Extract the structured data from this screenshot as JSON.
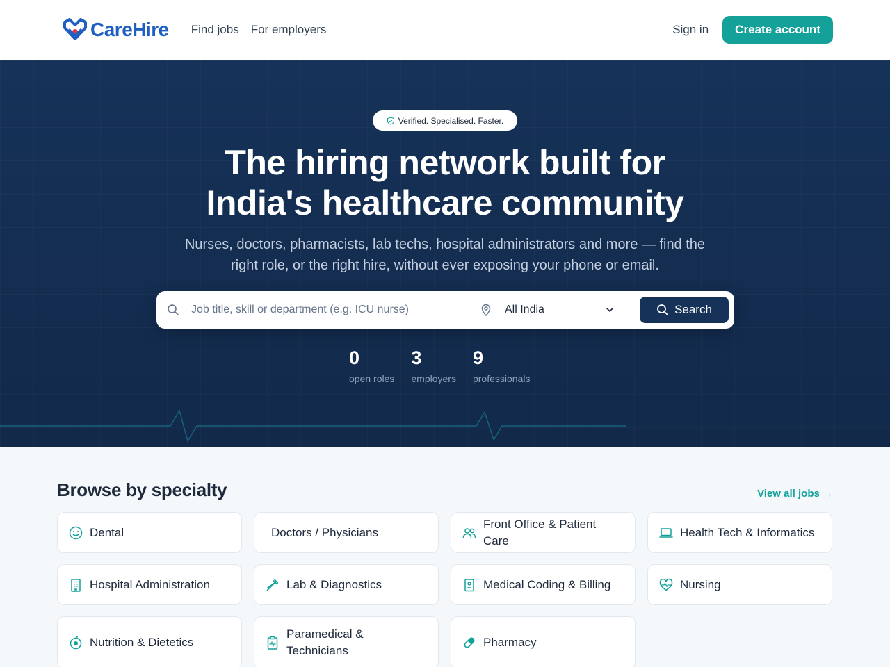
{
  "brand": {
    "name": "CareHire",
    "accent": "#14a19a",
    "navy": "#163258",
    "logo_blue": "#1f5fc2"
  },
  "header": {
    "nav": [
      "Find jobs",
      "For employers"
    ],
    "sign_in": "Sign in",
    "create_account": "Create account"
  },
  "hero": {
    "badge": "Verified. Specialised. Faster.",
    "title_line1": "The hiring network built for",
    "title_line2": "India's healthcare community",
    "subtitle_line1": "Nurses, doctors, pharmacists, lab techs, hospital administrators and more — find the",
    "subtitle_line2": "right role, or the right hire, without ever exposing your phone or email.",
    "search": {
      "placeholder": "Job title, skill or department (e.g. ICU nurse)",
      "location": "All India",
      "button": "Search"
    },
    "stats": [
      {
        "value": "0",
        "label": "open roles"
      },
      {
        "value": "3",
        "label": "employers"
      },
      {
        "value": "9",
        "label": "professionals"
      }
    ]
  },
  "browse": {
    "title": "Browse by specialty",
    "view_all": "View all jobs →",
    "specialties": [
      {
        "label": "Dental",
        "icon": "smile-icon"
      },
      {
        "label": "Doctors / Physicians",
        "icon": ""
      },
      {
        "label": "Front Office & Patient Care",
        "icon": "users-icon"
      },
      {
        "label": "Health Tech & Informatics",
        "icon": "laptop-icon"
      },
      {
        "label": "Hospital Administration",
        "icon": "building-icon"
      },
      {
        "label": "Lab & Diagnostics",
        "icon": "pipette-icon"
      },
      {
        "label": "Medical Coding & Billing",
        "icon": "id-badge-icon"
      },
      {
        "label": "Nursing",
        "icon": "heart-pulse-icon"
      },
      {
        "label": "Nutrition & Dietetics",
        "icon": "apple-icon"
      },
      {
        "label": "Paramedical & Technicians",
        "icon": "clipboard-pulse-icon"
      },
      {
        "label": "Pharmacy",
        "icon": "pill-icon"
      }
    ]
  }
}
